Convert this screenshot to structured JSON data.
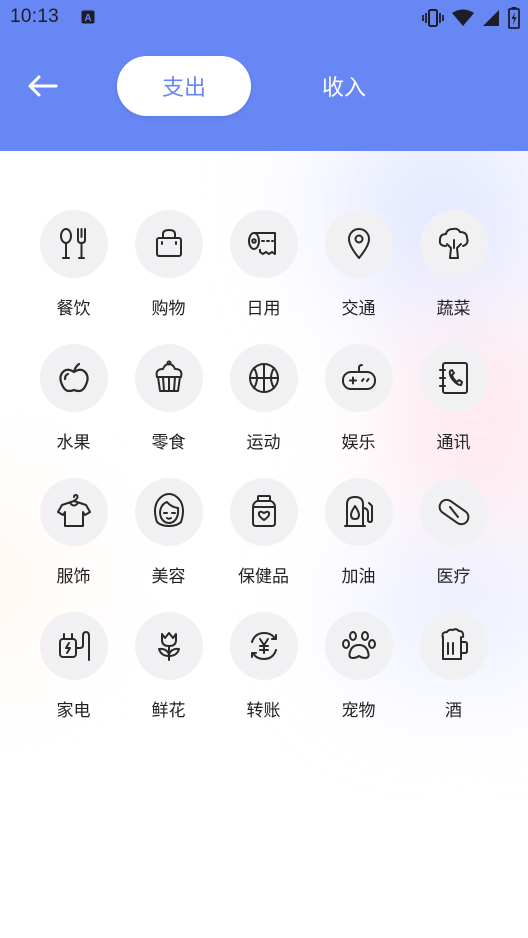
{
  "status_bar": {
    "time": "10:13",
    "icons": [
      "notification-a-icon",
      "vibrate-icon",
      "wifi-icon",
      "signal-icon",
      "battery-icon"
    ]
  },
  "header": {
    "back_icon": "arrow-left-icon",
    "tabs": [
      {
        "label": "支出",
        "active": true
      },
      {
        "label": "收入",
        "active": false
      }
    ]
  },
  "colors": {
    "accent": "#6787f5",
    "icon_bg": "#f1f1f3",
    "icon_stroke": "#2a2a2a",
    "label": "#222222"
  },
  "categories": [
    {
      "label": "餐饮",
      "icon": "fork-spoon-icon"
    },
    {
      "label": "购物",
      "icon": "shopping-bag-icon"
    },
    {
      "label": "日用",
      "icon": "toilet-paper-icon"
    },
    {
      "label": "交通",
      "icon": "location-pin-icon"
    },
    {
      "label": "蔬菜",
      "icon": "broccoli-icon"
    },
    {
      "label": "水果",
      "icon": "apple-icon"
    },
    {
      "label": "零食",
      "icon": "cupcake-icon"
    },
    {
      "label": "运动",
      "icon": "basketball-icon"
    },
    {
      "label": "娱乐",
      "icon": "gamepad-icon"
    },
    {
      "label": "通讯",
      "icon": "phone-book-icon"
    },
    {
      "label": "服饰",
      "icon": "tshirt-icon"
    },
    {
      "label": "美容",
      "icon": "woman-face-icon"
    },
    {
      "label": "保健品",
      "icon": "medicine-jar-icon"
    },
    {
      "label": "加油",
      "icon": "fuel-pump-icon"
    },
    {
      "label": "医疗",
      "icon": "pill-icon"
    },
    {
      "label": "家电",
      "icon": "plug-icon"
    },
    {
      "label": "鲜花",
      "icon": "tulip-icon"
    },
    {
      "label": "转账",
      "icon": "transfer-yen-icon"
    },
    {
      "label": "宠物",
      "icon": "paw-icon"
    },
    {
      "label": "酒",
      "icon": "beer-mug-icon"
    }
  ]
}
